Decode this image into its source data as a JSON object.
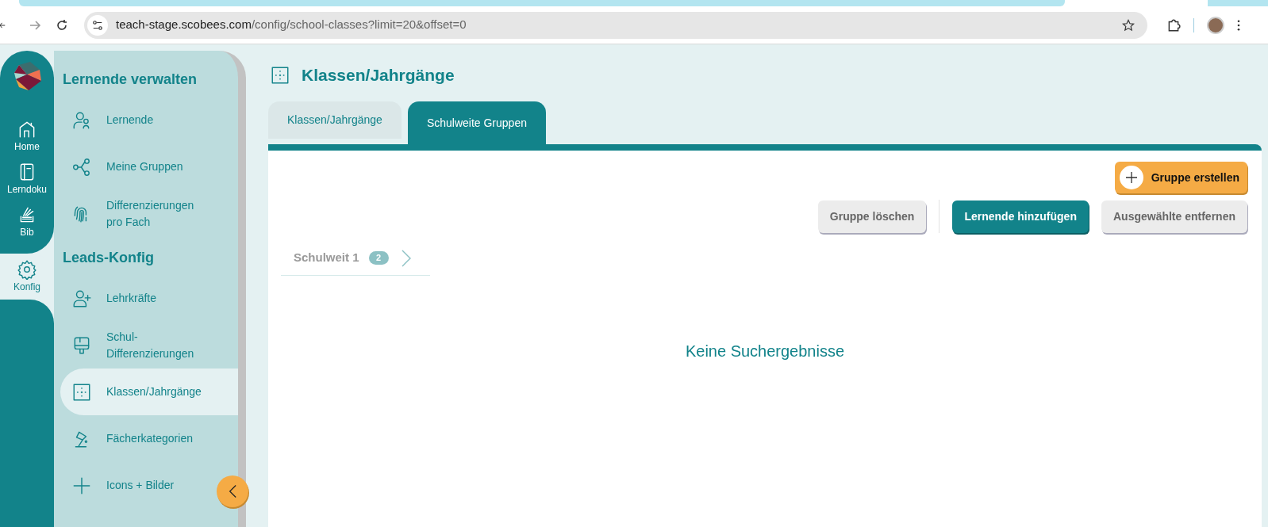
{
  "browser": {
    "url_host": "teach-stage.scobees.com",
    "url_path": "/config/school-classes?limit=20&offset=0"
  },
  "rail": [
    {
      "label": "Home",
      "selected": false
    },
    {
      "label": "Lerndoku",
      "selected": false
    },
    {
      "label": "Bib",
      "selected": false
    },
    {
      "label": "Konfig",
      "selected": true
    }
  ],
  "sidebar": [
    {
      "title": "Lernende verwalten",
      "items": [
        {
          "label": "Lernende",
          "selected": false
        },
        {
          "label": "Meine Gruppen",
          "selected": false
        },
        {
          "label": "Differenzierungen pro Fach",
          "selected": false
        }
      ]
    },
    {
      "title": "Leads-Konfig",
      "items": [
        {
          "label": "Lehrkräfte",
          "selected": false
        },
        {
          "label": "Schul-Differenzierungen",
          "selected": false
        },
        {
          "label": "Klassen/Jahrgänge",
          "selected": true
        },
        {
          "label": "Fächerkategorien",
          "selected": false
        },
        {
          "label": "Icons + Bilder",
          "selected": false
        }
      ]
    }
  ],
  "page": {
    "title": "Klassen/Jahrgänge",
    "tabs": [
      {
        "label": "Klassen/Jahrgänge",
        "selected": false
      },
      {
        "label": "Schulweite Gruppen",
        "selected": true
      }
    ],
    "create_button": "Gruppe erstellen",
    "actions": [
      {
        "label": "Gruppe löschen",
        "kind": "secondary"
      },
      {
        "label": "Lernende hinzufügen",
        "kind": "primary"
      },
      {
        "label": "Ausgewählte entfernen",
        "kind": "secondary"
      }
    ],
    "groups": [
      {
        "name": "Schulweit 1",
        "count": "2"
      }
    ],
    "empty_message": "Keine Suchergebnisse"
  }
}
